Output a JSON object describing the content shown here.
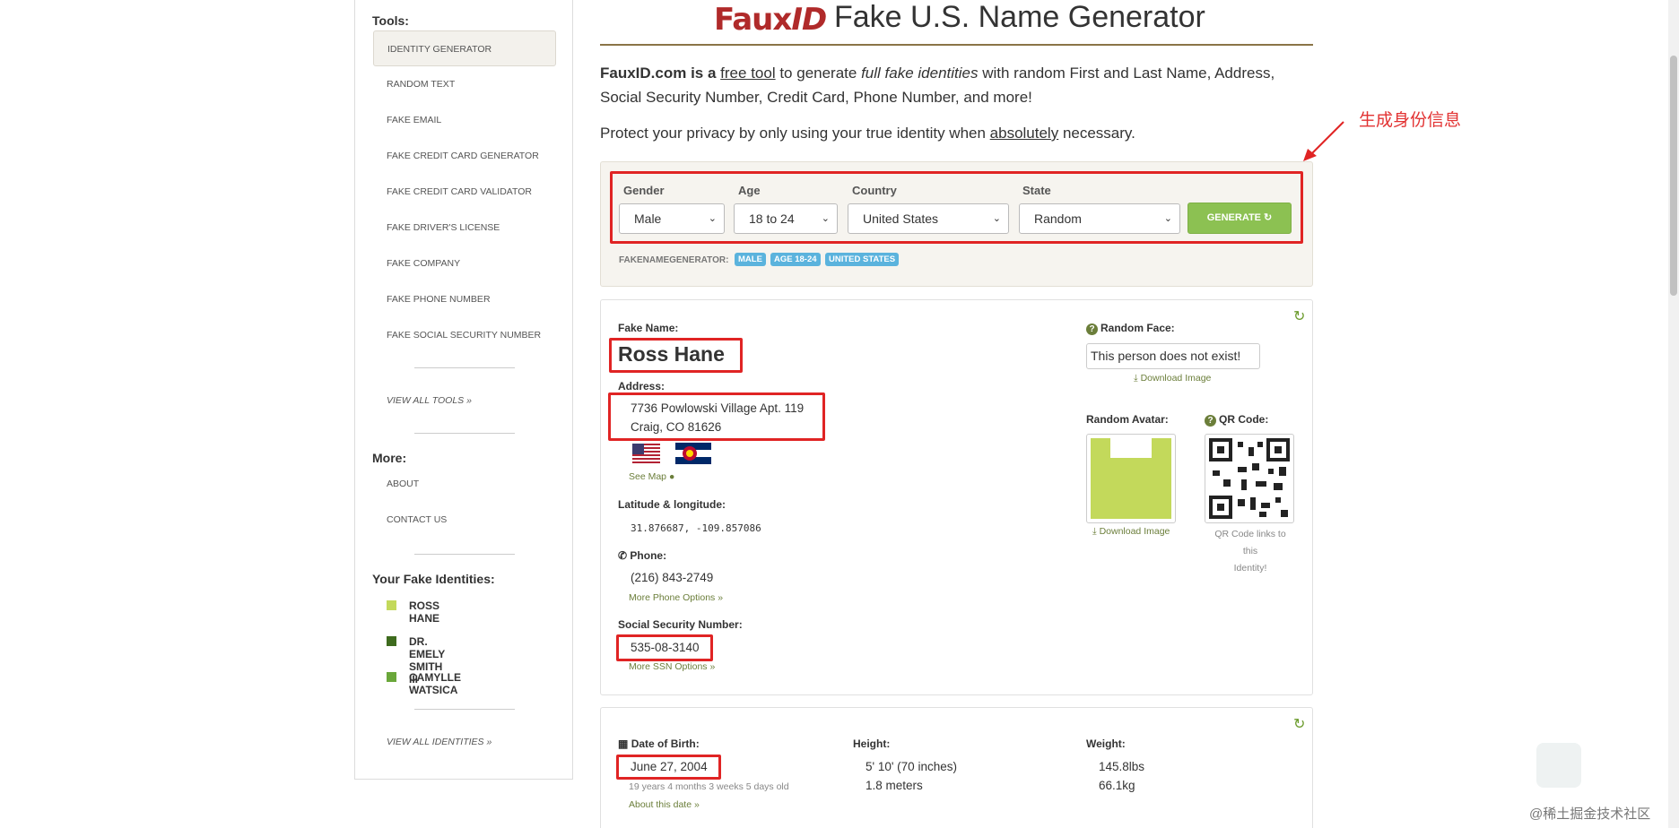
{
  "sidebar": {
    "tools_heading": "Tools:",
    "tools": [
      {
        "label": "IDENTITY GENERATOR",
        "active": true
      },
      {
        "label": "RANDOM TEXT"
      },
      {
        "label": "FAKE EMAIL"
      },
      {
        "label": "FAKE CREDIT CARD GENERATOR"
      },
      {
        "label": "FAKE CREDIT CARD VALIDATOR"
      },
      {
        "label": "FAKE DRIVER'S LICENSE"
      },
      {
        "label": "FAKE COMPANY"
      },
      {
        "label": "FAKE PHONE NUMBER"
      },
      {
        "label": "FAKE SOCIAL SECURITY NUMBER"
      }
    ],
    "view_all_tools": "VIEW ALL TOOLS »",
    "more_heading": "More:",
    "more": [
      {
        "label": "ABOUT"
      },
      {
        "label": "CONTACT US"
      }
    ],
    "identities_heading": "Your Fake Identities:",
    "identities": [
      {
        "label": "ROSS HANE",
        "color": "#c3d95b"
      },
      {
        "label": "DR. EMELY SMITH III",
        "color": "#3e6b1e"
      },
      {
        "label": "CAMYLLE WATSICA",
        "color": "#6aa73a"
      }
    ],
    "view_all_identities": "VIEW ALL IDENTITIES »"
  },
  "header": {
    "logo_main": "Faux",
    "logo_id": "ID",
    "title": "Fake U.S. Name Generator"
  },
  "intro": {
    "p1_a": "FauxID.com is a ",
    "p1_link": "free tool",
    "p1_b": " to generate ",
    "p1_em": "full fake identities",
    "p1_c": " with random First and Last Name, Address, Social Security Number, Credit Card, Phone Number, and more!",
    "p2_a": "Protect your privacy by only using your true identity when ",
    "p2_link": "absolutely",
    "p2_b": " necessary."
  },
  "annotation": "生成身份信息",
  "form": {
    "gender_label": "Gender",
    "gender_value": "Male",
    "age_label": "Age",
    "age_value": "18 to 24",
    "country_label": "Country",
    "country_value": "United States",
    "state_label": "State",
    "state_value": "Random",
    "generate_label": "GENERATE ↻",
    "fng_label": "FAKENAMEGENERATOR:",
    "badges": [
      "MALE",
      "AGE 18-24",
      "UNITED STATES"
    ]
  },
  "identity": {
    "fake_name_label": "Fake Name:",
    "name": "Ross Hane",
    "address_label": "Address:",
    "address_line1": "7736 Powlowski Village Apt. 119",
    "address_line2": "Craig, CO 81626",
    "see_map": "See Map",
    "latlng_label": "Latitude & longitude:",
    "latlng": "31.876687, -109.857086",
    "phone_label": "Phone:",
    "phone": "(216) 843-2749",
    "more_phone": "More Phone Options »",
    "ssn_label": "Social Security Number:",
    "ssn": "535-08-3140",
    "more_ssn": "More SSN Options »",
    "random_face_label": "Random Face:",
    "face_alt": "This person does not exist!",
    "download_image": "Download Image",
    "random_avatar_label": "Random Avatar:",
    "qr_label": "QR Code:",
    "qr_note_1": "QR Code links to this",
    "qr_note_2": "Identity!"
  },
  "details": {
    "dob_label": "Date of Birth:",
    "dob": "June 27, 2004",
    "age_detail": "19 years 4 months 3 weeks 5 days old",
    "about_date": "About this date »",
    "height_label": "Height:",
    "height_ft": "5' 10' (70 inches)",
    "height_m": "1.8 meters",
    "weight_label": "Weight:",
    "weight_lbs": "145.8lbs",
    "weight_kg": "66.1kg"
  },
  "watermark": "@稀土掘金技术社区",
  "colors": {
    "accent_green": "#8cc152",
    "brand_red": "#b02a2a",
    "annotation_red": "#e02424",
    "badge_blue": "#5bb3dd"
  }
}
